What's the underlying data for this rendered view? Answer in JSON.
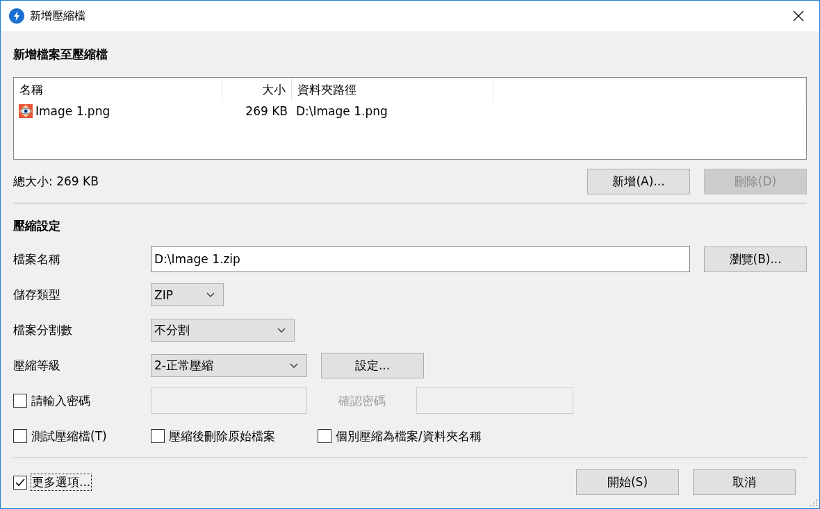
{
  "window": {
    "title": "新增壓縮檔"
  },
  "add_section": {
    "heading": "新增檔案至壓縮檔",
    "file_list": {
      "columns": [
        "名稱",
        "大小",
        "資料夾路徑"
      ],
      "rows": [
        {
          "name": "Image 1.png",
          "size": "269 KB",
          "path": "D:\\Image 1.png",
          "selected": false
        }
      ]
    },
    "total": "總大小: 269 KB",
    "buttons": [
      {
        "label": "新增(A)...",
        "disabled": false
      },
      {
        "label": "刪除(D)",
        "disabled": true
      }
    ]
  },
  "settings": {
    "heading": "壓縮設定",
    "fields": [
      {
        "kind": "input",
        "label": "檔案名稱",
        "value": "D:\\Image 1.zip",
        "button": "瀏覽(B)..."
      },
      {
        "kind": "select",
        "label": "儲存類型",
        "value": "ZIP"
      },
      {
        "kind": "select",
        "label": "檔案分割數",
        "value": "不分割"
      },
      {
        "kind": "select",
        "label": "壓縮等級",
        "value": "2-正常壓縮",
        "button": "設定..."
      }
    ],
    "password": {
      "label": "請輸入密碼",
      "checked": false,
      "confirm_label": "確認密碼"
    },
    "options": [
      {
        "label": "測試壓縮檔(T)",
        "checked": false
      },
      {
        "label": "壓縮後刪除原始檔案",
        "checked": false
      },
      {
        "label": "個別壓縮為檔案/資料夾名稱",
        "checked": false
      }
    ]
  },
  "footer": {
    "more_options": {
      "label": "更多選項...",
      "checked": true
    },
    "buttons": [
      "開始(S)",
      "取消"
    ]
  }
}
